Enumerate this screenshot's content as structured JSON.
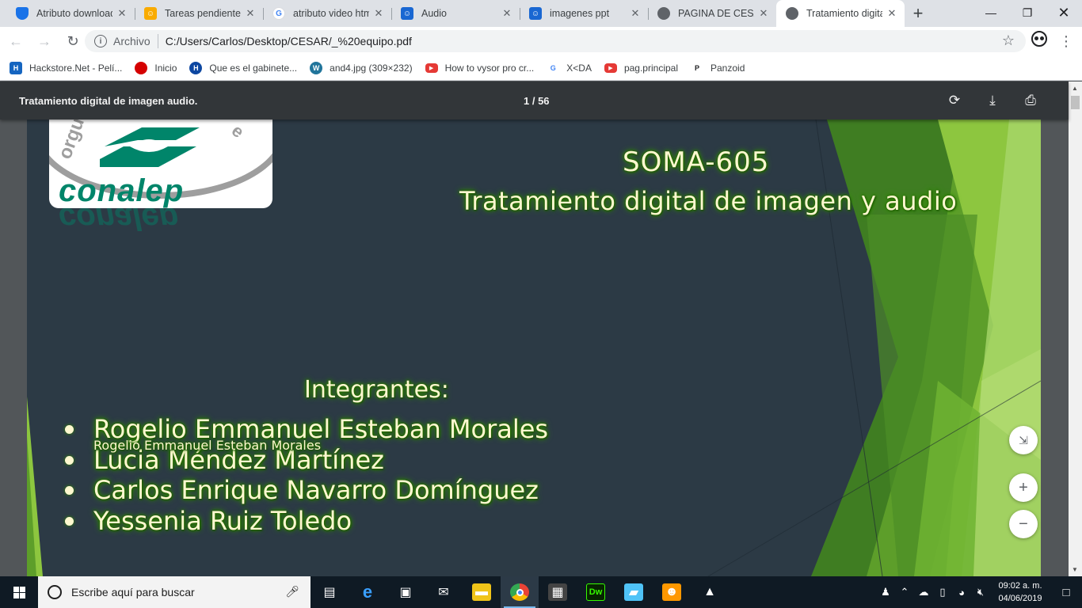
{
  "browser": {
    "tabs": [
      {
        "title": "Atributo download",
        "favicon": "shield-icon",
        "color": "#1a73e8",
        "active": false
      },
      {
        "title": "Tareas pendientes",
        "favicon": "classroom-icon",
        "color": "#f9ab00",
        "active": false
      },
      {
        "title": "atributo video htm",
        "favicon": "google-icon",
        "color": "#ffffff",
        "active": false
      },
      {
        "title": "Audio",
        "favicon": "classroom-icon",
        "color": "#1967d2",
        "active": false
      },
      {
        "title": "imagenes ppt",
        "favicon": "classroom-icon",
        "color": "#1967d2",
        "active": false
      },
      {
        "title": "PAGINA DE CESAR",
        "favicon": "globe-icon",
        "color": "#5f6368",
        "active": false
      },
      {
        "title": "Tratamiento digita",
        "favicon": "globe-icon",
        "color": "#5f6368",
        "active": true
      }
    ],
    "new_tab": "+",
    "address": {
      "scheme": "Archivo",
      "url": "C:/Users/Carlos/Desktop/CESAR/_%20equipo.pdf"
    },
    "bookmarks": [
      {
        "label": "Hackstore.Net - Pelí...",
        "icon": "hackstore-icon",
        "color": "#1565c0"
      },
      {
        "label": "Inicio",
        "icon": "red-circle-icon",
        "color": "#d50000"
      },
      {
        "label": "Que es el gabinete...",
        "icon": "h-icon",
        "color": "#0d47a1"
      },
      {
        "label": "and4.jpg (309×232)",
        "icon": "wordpress-icon",
        "color": "#21759b"
      },
      {
        "label": "How to vysor pro cr...",
        "icon": "youtube-icon",
        "color": "#e53935"
      },
      {
        "label": "X<DA",
        "icon": "google-icon",
        "color": "#4285f4"
      },
      {
        "label": "pag.principal",
        "icon": "youtube-icon",
        "color": "#e53935"
      },
      {
        "label": "Panzoid",
        "icon": "panzoid-icon",
        "color": "#202124"
      }
    ]
  },
  "pdf": {
    "title": "Tratamiento digital de imagen audio.",
    "page": "1 / 56"
  },
  "slide": {
    "logo_text": "conalep",
    "logo_arc_left": "orgu",
    "logo_arc_right": "e",
    "code": "SOMA-605",
    "subject": "Tratamiento digital de imagen y audio",
    "heading": "Integrantes:",
    "members": [
      "Rogelio Emmanuel Esteban Morales",
      "Lucia Méndez Martínez",
      "Carlos Enrique Navarro Domínguez",
      "Yessenia Ruiz Toledo"
    ],
    "colors": {
      "background": "#2c3a45",
      "accent_green": "#8dc63f",
      "text": "#fff8d0"
    }
  },
  "taskbar": {
    "search_placeholder": "Escribe aquí para buscar",
    "apps": [
      {
        "name": "task-view-icon",
        "color": "#0f1a24"
      },
      {
        "name": "edge-icon",
        "color": "#0078d7"
      },
      {
        "name": "store-icon",
        "color": "#0f1a24"
      },
      {
        "name": "mail-icon",
        "color": "#0f1a24"
      },
      {
        "name": "file-explorer-icon",
        "color": "#f0c419"
      },
      {
        "name": "chrome-icon",
        "color": "#4285f4"
      },
      {
        "name": "camera-app-icon",
        "color": "#444444"
      },
      {
        "name": "dreamweaver-icon",
        "color": "#35fa00"
      },
      {
        "name": "notes-app-icon",
        "color": "#4fc3f7"
      },
      {
        "name": "scratch-icon",
        "color": "#ff9800"
      },
      {
        "name": "photos-icon",
        "color": "#0f1a24"
      }
    ],
    "dreamweaver_label": "Dw",
    "time": "09:02 a. m.",
    "date": "04/06/2019"
  }
}
